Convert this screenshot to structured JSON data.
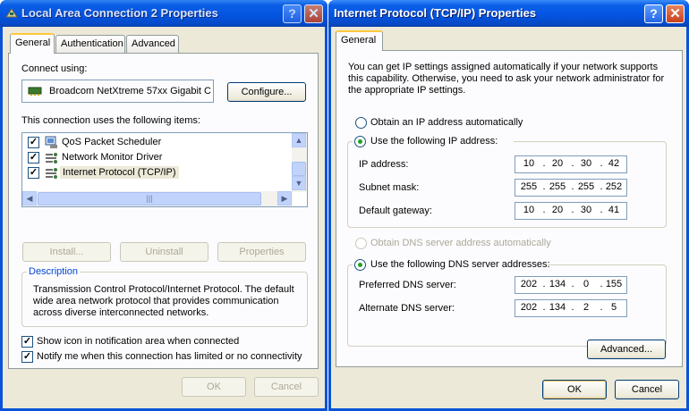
{
  "left_window": {
    "title": "Local Area Connection 2 Properties",
    "tabs": [
      "General",
      "Authentication",
      "Advanced"
    ],
    "connect_using_label": "Connect using:",
    "adapter_name": "Broadcom NetXtreme 57xx Gigabit C",
    "configure_button": "Configure...",
    "items_label": "This connection uses the following items:",
    "items": [
      {
        "label": "QoS Packet Scheduler",
        "checked": true,
        "icon": "scheduler-icon"
      },
      {
        "label": "Network Monitor Driver",
        "checked": true,
        "icon": "network-protocol-icon"
      },
      {
        "label": "Internet Protocol (TCP/IP)",
        "checked": true,
        "icon": "network-protocol-icon"
      }
    ],
    "install_button": "Install...",
    "uninstall_button": "Uninstall",
    "properties_button": "Properties",
    "description_label": "Description",
    "description_text": [
      "Transmission Control Protocol/Internet Protocol. The default",
      "wide area network protocol that provides communication",
      "across diverse interconnected networks."
    ],
    "show_icon_label": "Show icon in notification area when connected",
    "notify_label": "Notify me when this connection has limited or no connectivity",
    "ok_button": "OK",
    "cancel_button": "Cancel"
  },
  "right_window": {
    "title": "Internet Protocol (TCP/IP) Properties",
    "tab": "General",
    "intro_text": [
      "You can get IP settings assigned automatically if your network supports",
      "this capability. Otherwise, you need to ask your network administrator for",
      "the appropriate IP settings."
    ],
    "obtain_ip_auto": "Obtain an IP address automatically",
    "use_following_ip": "Use the following IP address:",
    "ip_label": "IP address:",
    "ip_address": [
      "10",
      "20",
      "30",
      "42"
    ],
    "subnet_label": "Subnet mask:",
    "subnet_mask": [
      "255",
      "255",
      "255",
      "252"
    ],
    "gateway_label": "Default gateway:",
    "default_gateway": [
      "10",
      "20",
      "30",
      "41"
    ],
    "obtain_dns_auto": "Obtain DNS server address automatically",
    "use_following_dns": "Use the following DNS server addresses:",
    "preferred_dns_label": "Preferred DNS server:",
    "preferred_dns": [
      "202",
      "134",
      "0",
      "155"
    ],
    "alternate_dns_label": "Alternate DNS server:",
    "alternate_dns": [
      "202",
      "134",
      "2",
      "5"
    ],
    "advanced_button": "Advanced...",
    "ok_button": "OK",
    "cancel_button": "Cancel"
  },
  "colors": {
    "titlebar": "#0454e1",
    "dialog_bg": "#ece9d8",
    "panel_bg": "#fcfcfe",
    "selection": "#ece9d8",
    "radio_dot": "#21a121",
    "group_label": "#0046d5"
  }
}
